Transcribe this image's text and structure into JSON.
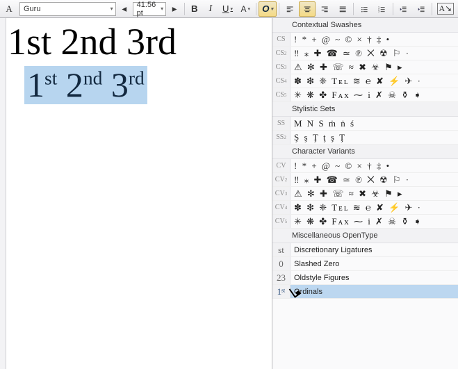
{
  "toolbar": {
    "font_name": "Guru",
    "font_size": "41.56 pt",
    "bold_label": "B",
    "italic_label": "I",
    "underline_label": "U",
    "opentype_label": "O"
  },
  "document": {
    "line1": "1st 2nd 3rd",
    "line2_parts": {
      "p1": "1",
      "s1": "st",
      "p2": " 2",
      "s2": "nd",
      "p3": " 3",
      "s3": "rd"
    }
  },
  "panel": {
    "sections": {
      "contextual_swashes": {
        "title": "Contextual Swashes",
        "rows": [
          {
            "tag": "CS",
            "glyphs": "! * + @ ~ © × † ‡ •"
          },
          {
            "tag": "CS2",
            "glyphs": "‼ ⁎ ✚ ☎ ≃ ℗ ⨉ ☢ ⚐ ·"
          },
          {
            "tag": "CS3",
            "glyphs": "⚠ ✻ ✚ ☏ ≈  ✖ ☣ ⚑ ▸"
          },
          {
            "tag": "CS4",
            "glyphs": "✽ ❇ ❈ Tᴇʟ ≋ ℮ ✘ ⚡ ✈ ·"
          },
          {
            "tag": "CS5",
            "glyphs": "✳ ❋ ✤ Fᴀx ⁓ i ✗ ☠ ⚱ ➧"
          }
        ]
      },
      "stylistic_sets": {
        "title": "Stylistic Sets",
        "rows": [
          {
            "tag": "SS",
            "glyphs": "M N S ṁ ṅ ś"
          },
          {
            "tag": "SS2",
            "glyphs": "Ş ş Ţ ţ ş Ţ"
          }
        ]
      },
      "character_variants": {
        "title": "Character Variants",
        "rows": [
          {
            "tag": "CV",
            "glyphs": "! * + @ ~ © × † ‡ •"
          },
          {
            "tag": "CV2",
            "glyphs": "‼ ⁎ ✚ ☎ ≃ ℗ ⨉ ☢ ⚐ ·"
          },
          {
            "tag": "CV3",
            "glyphs": "⚠ ✻ ✚ ☏ ≈  ✖ ☣ ⚑ ▸"
          },
          {
            "tag": "CV4",
            "glyphs": "✽ ❇ ❈ Tᴇʟ ≋ ℮ ✘ ⚡ ✈ ·"
          },
          {
            "tag": "CV5",
            "glyphs": "✳ ❋ ✤ Fᴀx ⁓ i ✗ ☠ ⚱ ➧"
          }
        ]
      },
      "misc_opentype": {
        "title": "Miscellaneous  OpenType",
        "rows": [
          {
            "tag_special": "st",
            "label": "Discretionary Ligatures"
          },
          {
            "tag_special": "0",
            "label": "Slashed Zero"
          },
          {
            "tag_special": "23",
            "label": "Oldstyle Figures"
          },
          {
            "tag_special": "1ˢᵗ",
            "label": "Ordinals",
            "selected": true
          }
        ]
      }
    }
  }
}
